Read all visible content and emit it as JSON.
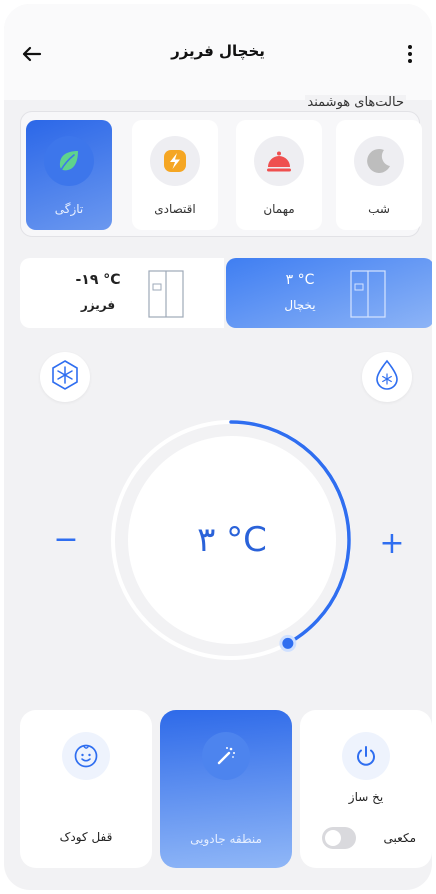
{
  "header": {
    "title": "یخچال فریزر"
  },
  "smart_modes": {
    "title": "حالت‌های هوشمند",
    "items": [
      {
        "label": "شب",
        "icon": "moon-icon"
      },
      {
        "label": "مهمان",
        "icon": "cloche-icon"
      },
      {
        "label": "اقتصادی",
        "icon": "lightning-icon"
      },
      {
        "label": "تازگی",
        "icon": "leaf-icon",
        "active": true
      }
    ]
  },
  "compartments": {
    "fridge": {
      "name": "یخچال",
      "temp": "۳ °C",
      "selected": true
    },
    "freezer": {
      "name": "فریزر",
      "temp": "-۱۹ °C",
      "selected": false
    }
  },
  "dial": {
    "value": "۳ °C",
    "minus_label": "−",
    "plus_label": "+",
    "level_fraction": 0.42
  },
  "cards": {
    "ice_maker": {
      "label": "یخ ساز",
      "cube_label": "مکعبی",
      "cube_on": false
    },
    "magic_zone": {
      "label": "منطقه جادویی"
    },
    "child_lock": {
      "label": "قفل کودک"
    }
  },
  "colors": {
    "accent": "#2f6ef0",
    "background": "#f2f2f4",
    "card": "#ffffff",
    "leaf": "#5fd38d",
    "lightning": "#f5a623",
    "cloche": "#ef4f4f",
    "moon": "#bdbdbd"
  }
}
